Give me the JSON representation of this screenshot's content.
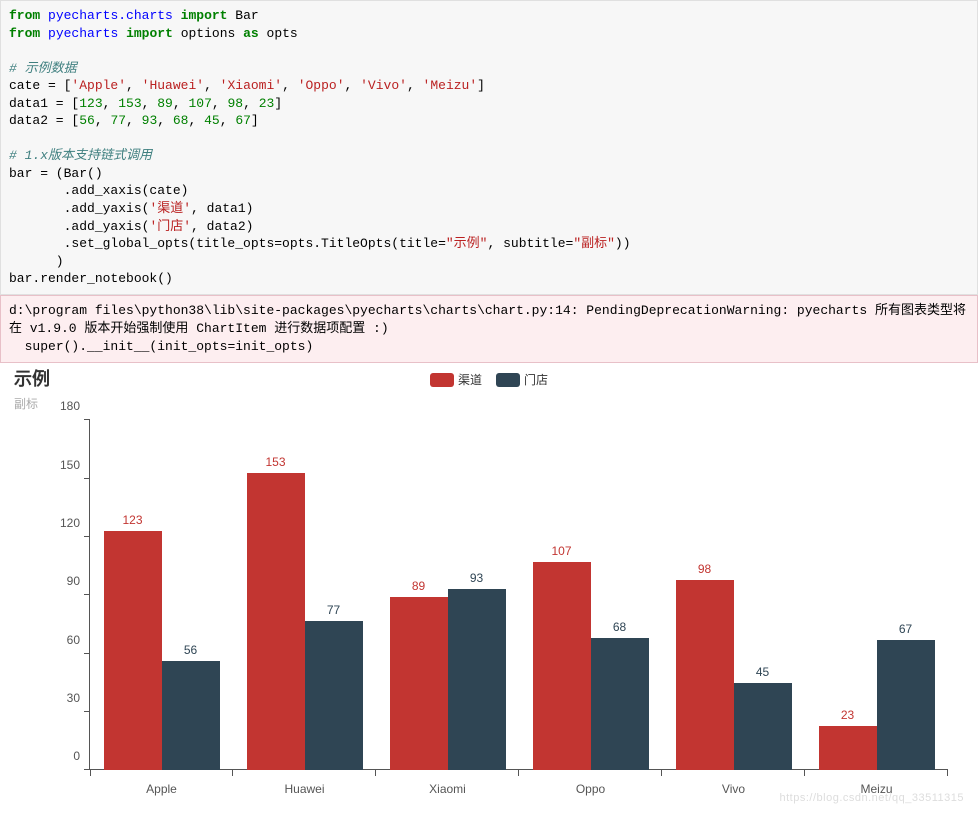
{
  "code": {
    "line1_from": "from",
    "line1_mod1": "pyecharts.charts",
    "line1_import": "import",
    "line1_item": "Bar",
    "line2_from": "from",
    "line2_mod1": "pyecharts",
    "line2_import": "import",
    "line2_item": "options",
    "line2_as": "as",
    "line2_alias": "opts",
    "cmt1": "# 示例数据",
    "cate_lhs": "cate = [",
    "cate_v0": "'Apple'",
    "cate_v1": "'Huawei'",
    "cate_v2": "'Xiaomi'",
    "cate_v3": "'Oppo'",
    "cate_v4": "'Vivo'",
    "cate_v5": "'Meizu'",
    "cate_rhs": "]",
    "d1_lhs": "data1 = [",
    "d1_v0": "123",
    "d1_v1": "153",
    "d1_v2": "89",
    "d1_v3": "107",
    "d1_v4": "98",
    "d1_v5": "23",
    "d1_rhs": "]",
    "d2_lhs": "data2 = [",
    "d2_v0": "56",
    "d2_v1": "77",
    "d2_v2": "93",
    "d2_v3": "68",
    "d2_v4": "45",
    "d2_v5": "67",
    "d2_rhs": "]",
    "cmt2": "# 1.x版本支持链式调用",
    "bar_assign": "bar = (Bar()",
    "add_x": "       .add_xaxis(cate)",
    "add_y1_a": "       .add_yaxis(",
    "add_y1_s": "'渠道'",
    "add_y1_b": ", data1)",
    "add_y2_a": "       .add_yaxis(",
    "add_y2_s": "'门店'",
    "add_y2_b": ", data2)",
    "setg_a": "       .set_global_opts(title_opts=opts.TitleOpts(title=",
    "setg_t": "\"示例\"",
    "setg_b": ", subtitle=",
    "setg_s": "\"副标\"",
    "setg_c": "))",
    "close": "      )",
    "render": "bar.render_notebook()"
  },
  "warning": "d:\\program files\\python38\\lib\\site-packages\\pyecharts\\charts\\chart.py:14: PendingDeprecationWarning: pyecharts 所有图表类型将在 v1.9.0 版本开始强制使用 ChartItem 进行数据项配置 :)\n  super().__init__(init_opts=init_opts)",
  "chart": {
    "title": "示例",
    "subtitle": "副标",
    "legend": {
      "s1": "渠道",
      "s2": "门店"
    },
    "colors": {
      "s1": "#c23531",
      "s2": "#2f4554"
    },
    "yticks": [
      "0",
      "30",
      "60",
      "90",
      "120",
      "150",
      "180"
    ],
    "categories": [
      "Apple",
      "Huawei",
      "Xiaomi",
      "Oppo",
      "Vivo",
      "Meizu"
    ],
    "series1": [
      "123",
      "153",
      "89",
      "107",
      "98",
      "23"
    ],
    "series2": [
      "56",
      "77",
      "93",
      "68",
      "45",
      "67"
    ]
  },
  "watermark": "https://blog.csdn.net/qq_33511315",
  "chart_data": {
    "type": "bar",
    "title": "示例",
    "subtitle": "副标",
    "xlabel": "",
    "ylabel": "",
    "ylim": [
      0,
      180
    ],
    "yticks": [
      0,
      30,
      60,
      90,
      120,
      150,
      180
    ],
    "categories": [
      "Apple",
      "Huawei",
      "Xiaomi",
      "Oppo",
      "Vivo",
      "Meizu"
    ],
    "series": [
      {
        "name": "渠道",
        "color": "#c23531",
        "values": [
          123,
          153,
          89,
          107,
          98,
          23
        ]
      },
      {
        "name": "门店",
        "color": "#2f4554",
        "values": [
          56,
          77,
          93,
          68,
          45,
          67
        ]
      }
    ],
    "legend_position": "top-center",
    "grid": false
  }
}
